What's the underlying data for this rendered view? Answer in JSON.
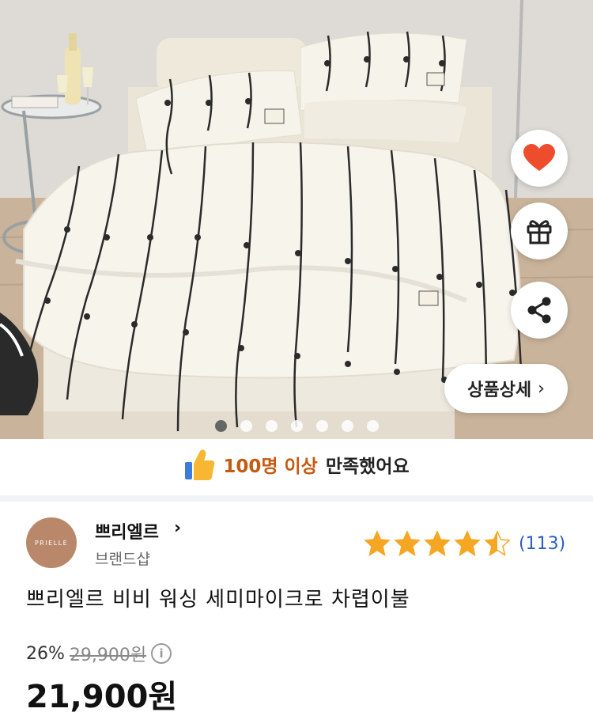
{
  "gallery": {
    "slide_count": 7,
    "active_index": 0,
    "detail_button_label": "상품상세",
    "detail_button_chevron": "›",
    "actions": [
      {
        "name": "heart-icon",
        "color": "#ee4d2d"
      },
      {
        "name": "gift-icon",
        "color": "#222222"
      },
      {
        "name": "share-icon",
        "color": "#222222"
      }
    ]
  },
  "satisfaction": {
    "icon": "thumbs-up-icon",
    "highlight": "100명 이상",
    "rest": "만족했어요"
  },
  "brand": {
    "logo_text": "PRIELLE",
    "name": "쁘리엘르",
    "chevron": "›",
    "subtitle": "브랜드샵"
  },
  "rating": {
    "stars": 4.5,
    "count": "(113)",
    "star_color": "#f5a623"
  },
  "product": {
    "title": "쁘리엘르 비비 워싱 세미마이크로 차렵이불",
    "discount": "26%",
    "original_price": "29,900원",
    "price": "21,900원"
  }
}
